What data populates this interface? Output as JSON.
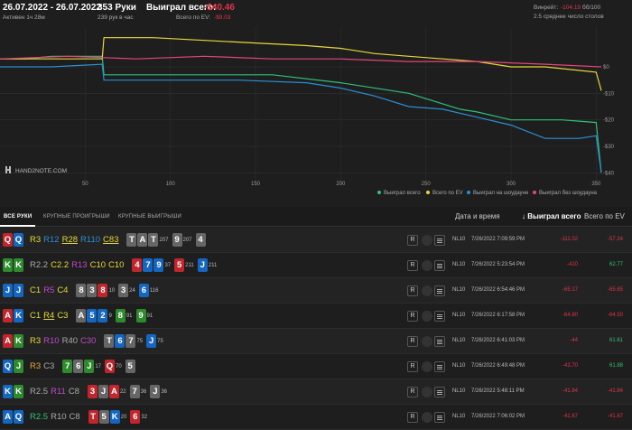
{
  "header": {
    "date_range": "26.07.2022 - 26.07.2022",
    "active": "Активен 1ч 28м",
    "hands": "353 Руки",
    "hands_per_hour": "239 рук в час",
    "won_label": "Выиграл всего:",
    "won_value": "-$40.46",
    "ev_label": "Всего по EV:",
    "ev_value": "-$9.03",
    "winrate_label": "Винрейт:",
    "winrate_value": "-104.19",
    "winrate_suffix": "бб/100",
    "tables": "2.5 среднее число столов"
  },
  "colors": {
    "total": "#2fc07a",
    "ev": "#e7d83a",
    "showdown": "#2a8fd4",
    "no_showdown": "#e6457a",
    "negative": "#e2334a",
    "positive": "#34c06e"
  },
  "chart_data": {
    "type": "line",
    "x_ticks": [
      "50",
      "100",
      "150",
      "200",
      "250",
      "300",
      "350"
    ],
    "y_ticks": [
      "$0",
      "-$10",
      "-$20",
      "-$30",
      "-$40"
    ],
    "xlim": [
      0,
      353
    ],
    "ylim": [
      -45,
      15
    ],
    "series": [
      {
        "name": "Выиграл всего",
        "key": "total",
        "x": [
          0,
          15,
          30,
          50,
          60,
          61,
          65,
          90,
          110,
          140,
          160,
          200,
          240,
          250,
          270,
          280,
          300,
          330,
          350,
          353
        ],
        "y": [
          3,
          3,
          4,
          4,
          4,
          -3,
          -3,
          -3,
          -3,
          -3,
          -3,
          -6,
          -10,
          -12,
          -16,
          -17,
          -20,
          -20,
          -21,
          -40
        ]
      },
      {
        "name": "Всего по EV",
        "key": "ev",
        "x": [
          0,
          20,
          40,
          60,
          61,
          90,
          120,
          150,
          180,
          200,
          220,
          240,
          260,
          280,
          300,
          320,
          350,
          353
        ],
        "y": [
          3,
          3,
          3,
          3,
          11,
          11,
          10,
          9,
          8,
          7,
          5,
          4,
          3,
          2,
          0,
          0,
          -2,
          -9
        ]
      },
      {
        "name": "Выиграл на шоудауне",
        "key": "showdown",
        "x": [
          0,
          30,
          60,
          61,
          100,
          140,
          180,
          200,
          220,
          240,
          260,
          280,
          300,
          320,
          340,
          350,
          353
        ],
        "y": [
          0,
          0,
          1,
          -5,
          -5,
          -5,
          -6,
          -8,
          -11,
          -15,
          -16,
          -19,
          -22,
          -27,
          -27,
          -26,
          -40
        ]
      },
      {
        "name": "Выиграл без шоудауна",
        "key": "no_showdown",
        "x": [
          0,
          40,
          80,
          120,
          160,
          200,
          240,
          280,
          320,
          353
        ],
        "y": [
          3,
          4,
          3,
          4,
          3,
          3,
          2,
          2,
          1,
          0
        ]
      }
    ]
  },
  "tabs": [
    "ВСЕ РУКИ",
    "КРУПНЫЕ ПРОИГРЫШИ",
    "КРУПНЫЕ ВЫИГРЫШИ"
  ],
  "columns": {
    "date": "Дата и время",
    "won": "Выиграл всего",
    "ev": "Всего по EV"
  },
  "rows": [
    {
      "hand": [
        [
          "Q",
          "r"
        ],
        [
          "Q",
          "b"
        ]
      ],
      "actions": [
        [
          "R3",
          "#e7d83a"
        ],
        [
          "R12",
          "#2a8fd4"
        ],
        [
          "R28",
          "#e7d83a",
          1
        ],
        [
          "R110",
          "#2a8fd4"
        ],
        [
          "C83",
          "#e7d83a",
          1
        ]
      ],
      "board": [
        [
          [
            "T",
            "k"
          ],
          [
            "A",
            "k"
          ],
          [
            "T",
            "k"
          ]
        ],
        [
          [
            "9",
            "k"
          ]
        ],
        [
          [
            "4",
            "k"
          ]
        ]
      ],
      "sizes": [
        "207",
        "207"
      ],
      "limit": "NL10",
      "date": "7/26/2022 7:09:59 PM",
      "won": "-111.02",
      "ev": "-57.24"
    },
    {
      "hand": [
        [
          "K",
          "g"
        ],
        [
          "K",
          "g"
        ]
      ],
      "actions": [
        [
          "R2.2",
          "#aaa"
        ],
        [
          "C2.2",
          "#e7d83a"
        ],
        [
          "R13",
          "#c04ac8"
        ],
        [
          "C10",
          "#e7d83a"
        ],
        [
          "C10",
          "#e7d83a"
        ]
      ],
      "board": [
        [
          [
            "4",
            "r"
          ],
          [
            "7",
            "b"
          ],
          [
            "9",
            "b"
          ]
        ],
        [
          [
            "5",
            "r"
          ]
        ],
        [
          [
            "J",
            "b"
          ]
        ]
      ],
      "sizes": [
        "37",
        "211",
        "211"
      ],
      "limit": "NL10",
      "date": "7/26/2022 5:23:54 PM",
      "won": "-410",
      "ev": "62.77"
    },
    {
      "hand": [
        [
          "J",
          "b"
        ],
        [
          "J",
          "b"
        ]
      ],
      "actions": [
        [
          "C1",
          "#e7d83a"
        ],
        [
          "R5",
          "#c04ac8"
        ],
        [
          "C4",
          "#e7d83a"
        ]
      ],
      "board": [
        [
          [
            "8",
            "k"
          ],
          [
            "3",
            "k"
          ],
          [
            "8",
            "r"
          ]
        ],
        [
          [
            "3",
            "k"
          ]
        ],
        [
          [
            "6",
            "b"
          ]
        ]
      ],
      "sizes": [
        "10",
        "24",
        "116"
      ],
      "limit": "NL10",
      "date": "7/26/2022 6:54:46 PM",
      "won": "-65.17",
      "ev": "-65.65"
    },
    {
      "hand": [
        [
          "A",
          "r"
        ],
        [
          "K",
          "b"
        ]
      ],
      "actions": [
        [
          "C1",
          "#e7d83a"
        ],
        [
          "R4",
          "#e7d83a",
          1
        ],
        [
          "C3",
          "#e7d83a"
        ]
      ],
      "board": [
        [
          [
            "A",
            "k"
          ],
          [
            "5",
            "b"
          ],
          [
            "2",
            "b"
          ]
        ],
        [
          [
            "8",
            "g"
          ]
        ],
        [
          [
            "9",
            "g"
          ]
        ]
      ],
      "sizes": [
        "9",
        "91",
        "91"
      ],
      "limit": "NL10",
      "date": "7/26/2022 6:17:58 PM",
      "won": "-64.80",
      "ev": "-64.50"
    },
    {
      "hand": [
        [
          "A",
          "r"
        ],
        [
          "K",
          "g"
        ]
      ],
      "actions": [
        [
          "R3",
          "#e7d83a"
        ],
        [
          "R10",
          "#c04ac8"
        ],
        [
          "R40",
          "#aaa"
        ],
        [
          "C30",
          "#c04ac8"
        ]
      ],
      "board": [
        [
          [
            "T",
            "k"
          ],
          [
            "6",
            "b"
          ],
          [
            "7",
            "k"
          ]
        ],
        [
          [
            "J",
            "b"
          ]
        ]
      ],
      "sizes": [
        "75",
        "75"
      ],
      "limit": "NL10",
      "date": "7/26/2022 6:41:03 PM",
      "won": "-44",
      "ev": "61.61"
    },
    {
      "hand": [
        [
          "Q",
          "b"
        ],
        [
          "J",
          "g"
        ]
      ],
      "actions": [
        [
          "R3",
          "#e7a63a"
        ],
        [
          "C3",
          "#aaa"
        ]
      ],
      "board": [
        [
          [
            "7",
            "g"
          ],
          [
            "6",
            "k"
          ],
          [
            "J",
            "g"
          ]
        ],
        [
          [
            "Q",
            "r"
          ]
        ],
        [
          [
            "5",
            "k"
          ]
        ]
      ],
      "sizes": [
        "17",
        "70"
      ],
      "limit": "NL10",
      "date": "7/26/2022 6:49:48 PM",
      "won": "-43.70",
      "ev": "61.88"
    },
    {
      "hand": [
        [
          "K",
          "b"
        ],
        [
          "K",
          "g"
        ]
      ],
      "actions": [
        [
          "R2.5",
          "#aaa"
        ],
        [
          "R11",
          "#c04ac8"
        ],
        [
          "C8",
          "#aaa"
        ]
      ],
      "board": [
        [
          [
            "3",
            "r"
          ],
          [
            "J",
            "k"
          ],
          [
            "A",
            "r"
          ]
        ],
        [
          [
            "7",
            "k"
          ]
        ],
        [
          [
            "J",
            "k"
          ]
        ]
      ],
      "sizes": [
        "22",
        "36",
        "36"
      ],
      "limit": "NL10",
      "date": "7/26/2022 5:48:11 PM",
      "won": "-41.84",
      "ev": "-41.84"
    },
    {
      "hand": [
        [
          "A",
          "b"
        ],
        [
          "Q",
          "b"
        ]
      ],
      "actions": [
        [
          "R2.5",
          "#2fc07a"
        ],
        [
          "R10",
          "#aaa"
        ],
        [
          "C8",
          "#aaa"
        ]
      ],
      "board": [
        [
          [
            "T",
            "r"
          ],
          [
            "5",
            "k"
          ],
          [
            "K",
            "b"
          ]
        ],
        [
          [
            "6",
            "r"
          ]
        ]
      ],
      "sizes": [
        "20",
        "32"
      ],
      "limit": "NL10",
      "date": "7/26/2022 7:06:02 PM",
      "won": "-41.67",
      "ev": "-41.67"
    }
  ],
  "legend": [
    "Выиграл всего",
    "Всего по EV",
    "Выиграл на шоудауне",
    "Выиграл без шоудауна"
  ],
  "logo": "HAND2NOTE.COM"
}
